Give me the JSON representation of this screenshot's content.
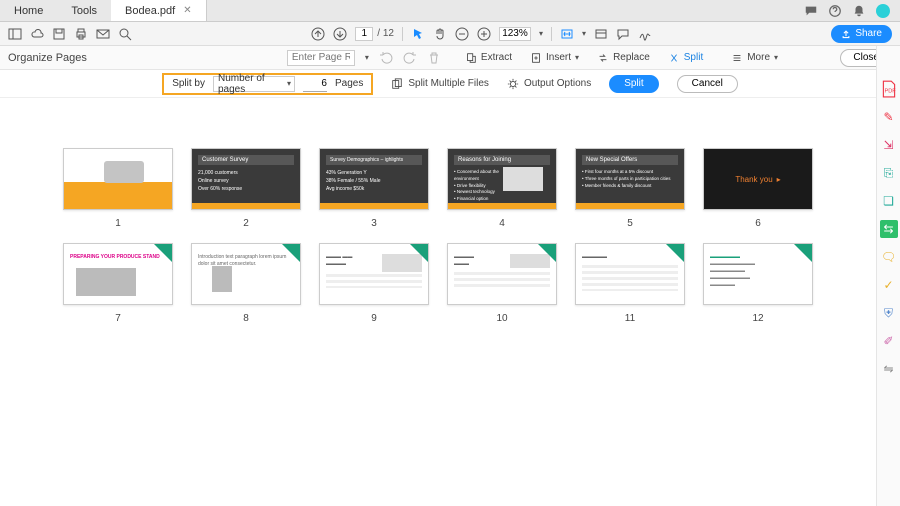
{
  "tabs": {
    "home": "Home",
    "tools": "Tools",
    "file": "Bodea.pdf"
  },
  "toolbar": {
    "page_current": "1",
    "page_total": "/ 12",
    "zoom": "123%",
    "share": "Share"
  },
  "organize": {
    "title": "Organize Pages",
    "range_placeholder": "Enter Page Range",
    "extract": "Extract",
    "insert": "Insert",
    "replace": "Replace",
    "split": "Split",
    "more": "More",
    "close": "Close"
  },
  "splitbar": {
    "splitby_label": "Split by",
    "splitby_value": "Number of pages",
    "count": "6",
    "pages_label": "Pages",
    "multi": "Split Multiple Files",
    "output": "Output Options",
    "split_btn": "Split",
    "cancel_btn": "Cancel"
  },
  "pages": [
    "1",
    "2",
    "3",
    "4",
    "5",
    "6",
    "7",
    "8",
    "9",
    "10",
    "11",
    "12"
  ],
  "thumbs": {
    "t2_title": "Customer Survey",
    "t3_title": "Survey Demographics – ighlights",
    "t4_title": "Reasons for Joining",
    "t5_title": "New Special Offers",
    "t6_text": "Thank you"
  },
  "rail_icons": [
    "pdf",
    "edit",
    "export",
    "create",
    "combine",
    "organize",
    "comment",
    "stamp",
    "fill",
    "protect",
    "redact",
    "compare"
  ]
}
